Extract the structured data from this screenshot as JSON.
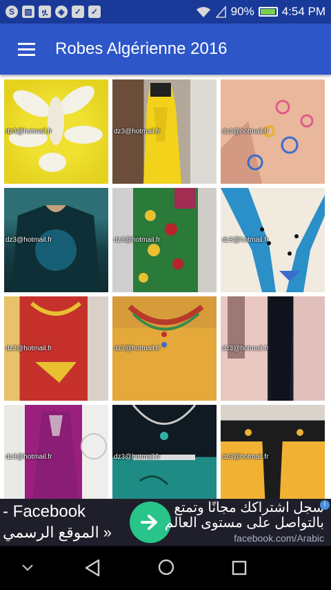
{
  "status_bar": {
    "battery": "90%",
    "time": "4:54 PM",
    "battery_level": 0.9,
    "icons": [
      "skype-icon",
      "image-icon",
      "group-icon",
      "shield-icon",
      "briefcase-icon",
      "briefcase-icon",
      "wifi-icon",
      "signal-icon",
      "battery-icon"
    ]
  },
  "app_bar": {
    "title": "Robes Algérienne 2016",
    "background": "#2d56c8"
  },
  "grid": {
    "items": [
      {
        "watermark": "dz3@hotmail.fr"
      },
      {
        "watermark": "dz3@hotmail.fr"
      },
      {
        "watermark": "dz3@hotmail.fr"
      },
      {
        "watermark": "dz3@hotmail.fr"
      },
      {
        "watermark": "dz3@hotmail.fr"
      },
      {
        "watermark": "dz3@hotmail.fr"
      },
      {
        "watermark": "dz3@hotmail.fr"
      },
      {
        "watermark": "dz3@hotmail.fr"
      },
      {
        "watermark": "dz3@hotmail.fr"
      },
      {
        "watermark": "dz3@hotmail.fr"
      },
      {
        "watermark": "dz3@hotmail.fr"
      },
      {
        "watermark": "dz3@hotmail.fr"
      }
    ]
  },
  "ad": {
    "left_line1": "- Facebook",
    "left_line2": "الموقع الرسمي »",
    "right_line1": "سجل اشتراكك مجانًا وتمتع",
    "right_line2": "بالتواصل على مستوى العالم",
    "domain": "facebook.com/Arabic",
    "accent": "#28c48a"
  },
  "nav_bar": {
    "icons": [
      "chevron-down-icon",
      "back-icon",
      "home-icon",
      "recents-icon"
    ]
  }
}
